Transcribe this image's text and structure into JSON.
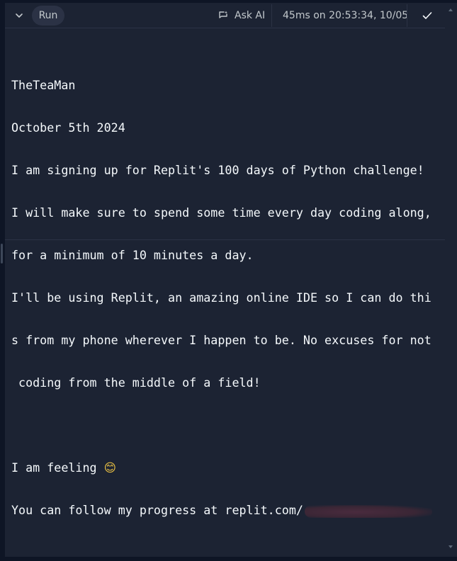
{
  "toolbar": {
    "run_label": "Run",
    "ask_ai_label": "Ask AI",
    "timing": "45ms on 20:53:34, 10/05"
  },
  "console": {
    "lines": [
      "",
      "TheTeaMan",
      "October 5th 2024",
      "I am signing up for Replit's 100 days of Python challenge!",
      "I will make sure to spend some time every day coding along,",
      "for a minimum of 10 minutes a day.",
      "I'll be using Replit, an amazing online IDE so I can do thi",
      "s from my phone wherever I happen to be. No excuses for not",
      " coding from the middle of a field!",
      "",
      "I am feeling ",
      "You can follow my progress at replit.com/"
    ],
    "feeling_emoji": "😊"
  },
  "icons": {
    "collapse": "chevron-down-icon",
    "ask_ai": "ai-chat-icon",
    "check": "check-icon",
    "scroll_up": "triangle-up-icon",
    "scroll_down": "triangle-down-icon"
  },
  "colors": {
    "background": "#1c2333",
    "outer": "#0e1525",
    "text": "#f5f9fc",
    "muted": "#c2c8cc",
    "button": "#2b3245"
  }
}
